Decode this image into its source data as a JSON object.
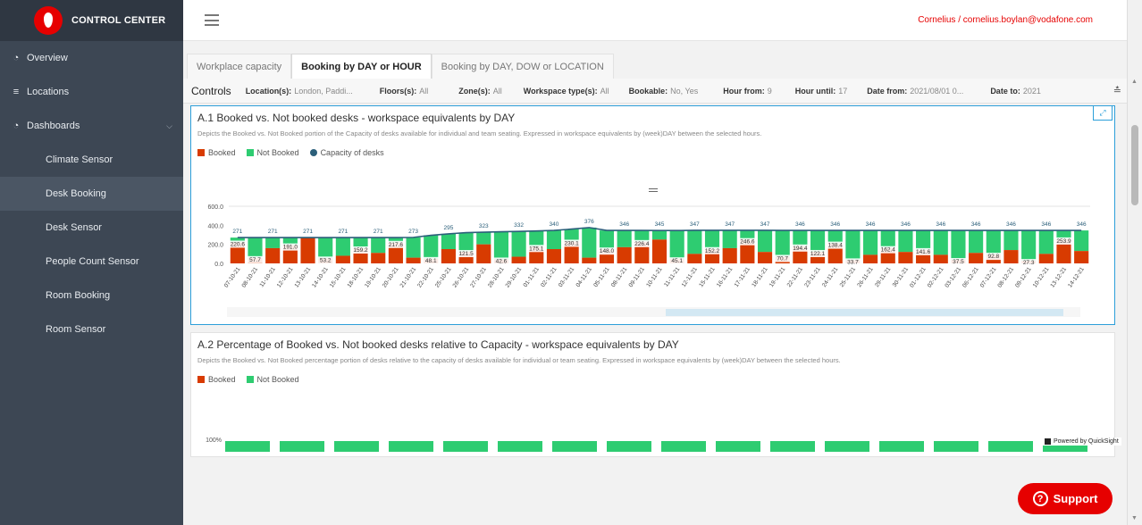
{
  "brand": {
    "title": "CONTROL CENTER"
  },
  "nav": [
    {
      "label": "Overview",
      "icon": "dashboard-icon",
      "level": "top"
    },
    {
      "label": "Locations",
      "icon": "signpost-icon",
      "level": "top"
    },
    {
      "label": "Dashboards",
      "icon": "dashboard-icon",
      "level": "top",
      "expanded": true
    },
    {
      "label": "Climate Sensor",
      "level": "sub"
    },
    {
      "label": "Desk Booking",
      "level": "sub",
      "active": true
    },
    {
      "label": "Desk Sensor",
      "level": "sub"
    },
    {
      "label": "People Count Sensor",
      "level": "sub"
    },
    {
      "label": "Room Booking",
      "level": "sub"
    },
    {
      "label": "Room Sensor",
      "level": "sub"
    }
  ],
  "header": {
    "user": "Cornelius / cornelius.boylan@vodafone.com"
  },
  "tabs": [
    {
      "label": "Workplace capacity",
      "active": false
    },
    {
      "label": "Booking by DAY or HOUR",
      "active": true
    },
    {
      "label": "Booking by DAY, DOW or LOCATION",
      "active": false
    }
  ],
  "controls": {
    "title": "Controls",
    "items": [
      {
        "label": "Location(s):",
        "value": "London, Paddi..."
      },
      {
        "label": "Floors(s):",
        "value": "All"
      },
      {
        "label": "Zone(s):",
        "value": "All"
      },
      {
        "label": "Workspace type(s):",
        "value": "All"
      },
      {
        "label": "Bookable:",
        "value": "No, Yes"
      },
      {
        "label": "Hour from:",
        "value": "9"
      },
      {
        "label": "Hour until:",
        "value": "17"
      },
      {
        "label": "Date from:",
        "value": "2021/08/01 0..."
      },
      {
        "label": "Date to:",
        "value": "2021"
      }
    ]
  },
  "card1": {
    "title": "A.1 Booked vs. Not booked desks - workspace equivalents by DAY",
    "description": "Depicts the Booked vs. Not Booked portion of the Capacity of desks available for individual and team seating. Expressed in workspace equivalents by (week)DAY between the selected hours.",
    "legend": [
      {
        "label": "Booked",
        "color": "#d83b01"
      },
      {
        "label": "Not Booked",
        "color": "#2ecc71"
      },
      {
        "label": "Capacity of desks",
        "color": "#2b5f7a"
      }
    ]
  },
  "card2": {
    "title": "A.2 Percentage of Booked vs. Not booked desks relative to Capacity - workspace equivalents by DAY",
    "description": "Depicts the Booked vs. Not Booked percentage portion of desks relative to the capacity of desks available for individual or team seating. Expressed in workspace equivalents by (week)DAY between the selected hours.",
    "legend": [
      {
        "label": "Booked",
        "color": "#d83b01"
      },
      {
        "label": "Not Booked",
        "color": "#2ecc71"
      }
    ],
    "ytick_top": "100%"
  },
  "powered_by": "Powered by QuickSight",
  "support": {
    "label": "Support"
  },
  "chart_data": {
    "type": "bar",
    "ylim": [
      0,
      600
    ],
    "yticks": [
      "0.0",
      "200.0",
      "400.0",
      "600.0"
    ],
    "categories": [
      "07-10-21",
      "08-10-21",
      "11-10-21",
      "12-10-21",
      "13-10-21",
      "14-10-21",
      "15-10-21",
      "18-10-21",
      "19-10-21",
      "20-10-21",
      "21-10-21",
      "22-10-21",
      "25-10-21",
      "26-10-21",
      "27-10-21",
      "28-10-21",
      "29-10-21",
      "01-11-21",
      "02-11-21",
      "03-11-21",
      "04-11-21",
      "05-11-21",
      "08-11-21",
      "09-11-21",
      "10-11-21",
      "11-11-21",
      "12-11-21",
      "15-11-21",
      "16-11-21",
      "17-11-21",
      "18-11-21",
      "19-11-21",
      "22-11-21",
      "23-11-21",
      "24-11-21",
      "25-11-21",
      "26-11-21",
      "29-11-21",
      "30-11-21",
      "01-12-21",
      "02-12-21",
      "03-12-21",
      "06-12-21",
      "07-12-21",
      "08-12-21",
      "09-12-21",
      "10-12-21",
      "13-12-21",
      "14-12-21"
    ],
    "booked": [
      220.6,
      57.7,
      160,
      191.0,
      270,
      53.2,
      80,
      159.2,
      110,
      217.6,
      60,
      48.1,
      150,
      121.5,
      200,
      42.6,
      70,
      175.1,
      150,
      230.1,
      60,
      148.0,
      170,
      226.4,
      250,
      45.1,
      100,
      152.2,
      160,
      246.6,
      120,
      70.7,
      180,
      122.1,
      210,
      33.7,
      90,
      162.4,
      120,
      141.6,
      90,
      37.5,
      110,
      92.8,
      140,
      27.3,
      100,
      253.9,
      130
    ],
    "capacity": [
      271,
      271,
      271,
      271,
      271,
      271,
      271,
      271,
      271,
      271,
      273,
      295,
      310,
      323,
      328,
      332,
      336,
      340,
      346,
      360,
      376,
      346,
      346,
      346,
      345,
      345,
      347,
      347,
      347,
      347,
      347,
      346,
      346,
      346,
      346,
      346,
      346,
      346,
      346,
      346,
      346,
      346,
      346,
      346,
      346,
      346,
      346,
      346,
      346
    ],
    "booked_labels": {
      "0": "220.6",
      "1": "57.7",
      "3": "191.0",
      "5": "53.2",
      "7": "159.2",
      "9": "217.6",
      "11": "48.1",
      "13": "121.5",
      "15": "42.6",
      "17": "175.1",
      "19": "230.1",
      "21": "148.0",
      "23": "226.4",
      "25": "45.1",
      "27": "152.2",
      "29": "246.6",
      "31": "70.7",
      "32": "194.4",
      "33": "122.1",
      "34": "138.4",
      "35": "33.7",
      "37": "162.4",
      "39": "141.6",
      "41": "37.5",
      "43": "92.8",
      "45": "27.3",
      "47": "253.9"
    },
    "capacity_labels": {
      "0": "271",
      "2": "271",
      "4": "271",
      "6": "271",
      "8": "271",
      "10": "273",
      "12": "295",
      "14": "323",
      "16": "332",
      "18": "340",
      "20": "376",
      "22": "346",
      "24": "345",
      "26": "347",
      "28": "347",
      "30": "347",
      "32": "346",
      "34": "346",
      "36": "346",
      "38": "346",
      "40": "346",
      "42": "346",
      "44": "346",
      "46": "346",
      "48": "346"
    }
  }
}
